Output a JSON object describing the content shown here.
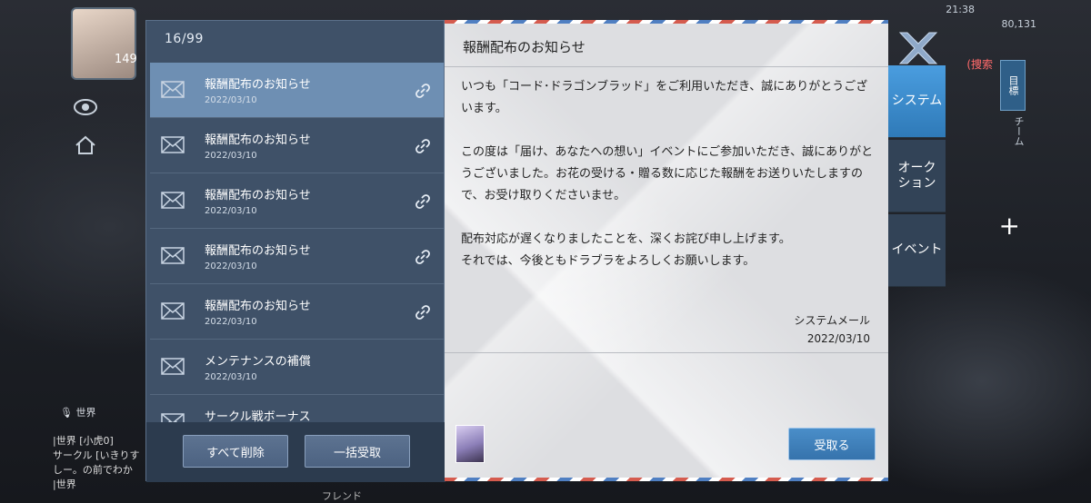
{
  "hud": {
    "level": "149",
    "time": "21:38",
    "money": "80,131",
    "search_label": "(捜索",
    "target_label": "目標",
    "team_label": "チーム",
    "world_tab": "世界",
    "friend_label": "フレンド",
    "chat_lines": [
      "|世界 [小虎0]",
      "サークル [いきりす",
      "しー。の前でわか",
      "|世界"
    ]
  },
  "mail_list": {
    "count": "16/99",
    "items": [
      {
        "title": "報酬配布のお知らせ",
        "date": "2022/03/10",
        "has_link": true
      },
      {
        "title": "報酬配布のお知らせ",
        "date": "2022/03/10",
        "has_link": true
      },
      {
        "title": "報酬配布のお知らせ",
        "date": "2022/03/10",
        "has_link": true
      },
      {
        "title": "報酬配布のお知らせ",
        "date": "2022/03/10",
        "has_link": true
      },
      {
        "title": "報酬配布のお知らせ",
        "date": "2022/03/10",
        "has_link": true
      },
      {
        "title": "メンテナンスの補償",
        "date": "2022/03/10",
        "has_link": false
      },
      {
        "title": "サークル戦ボーナス",
        "date": "",
        "has_link": false
      }
    ],
    "delete_all": "すべて削除",
    "receive_all": "一括受取"
  },
  "detail": {
    "title": "報酬配布のお知らせ",
    "paragraphs": [
      "いつも「コード･ドラゴンブラッド」をご利用いただき、誠にありがとうございます。",
      "この度は「届け、あなたへの想い」イベントにご参加いただき、誠にありがとうございました。お花の受ける・贈る数に応じた報酬をお送りいたしますので、お受け取りくださいませ。",
      "配布対応が遅くなりましたことを、深くお詫び申し上げます。\nそれでは、今後ともドラブラをよろしくお願いします。"
    ],
    "sender": "システムメール",
    "date": "2022/03/10",
    "claim": "受取る"
  },
  "tabs": [
    {
      "label": "システム",
      "active": true
    },
    {
      "label": "オーク\nション",
      "active": false
    },
    {
      "label": "イベント",
      "active": false
    }
  ],
  "colors": {
    "selected_item": "#6e8fb3",
    "active_tab": "#3a8bcc",
    "claim_button": "#3f80bb"
  }
}
